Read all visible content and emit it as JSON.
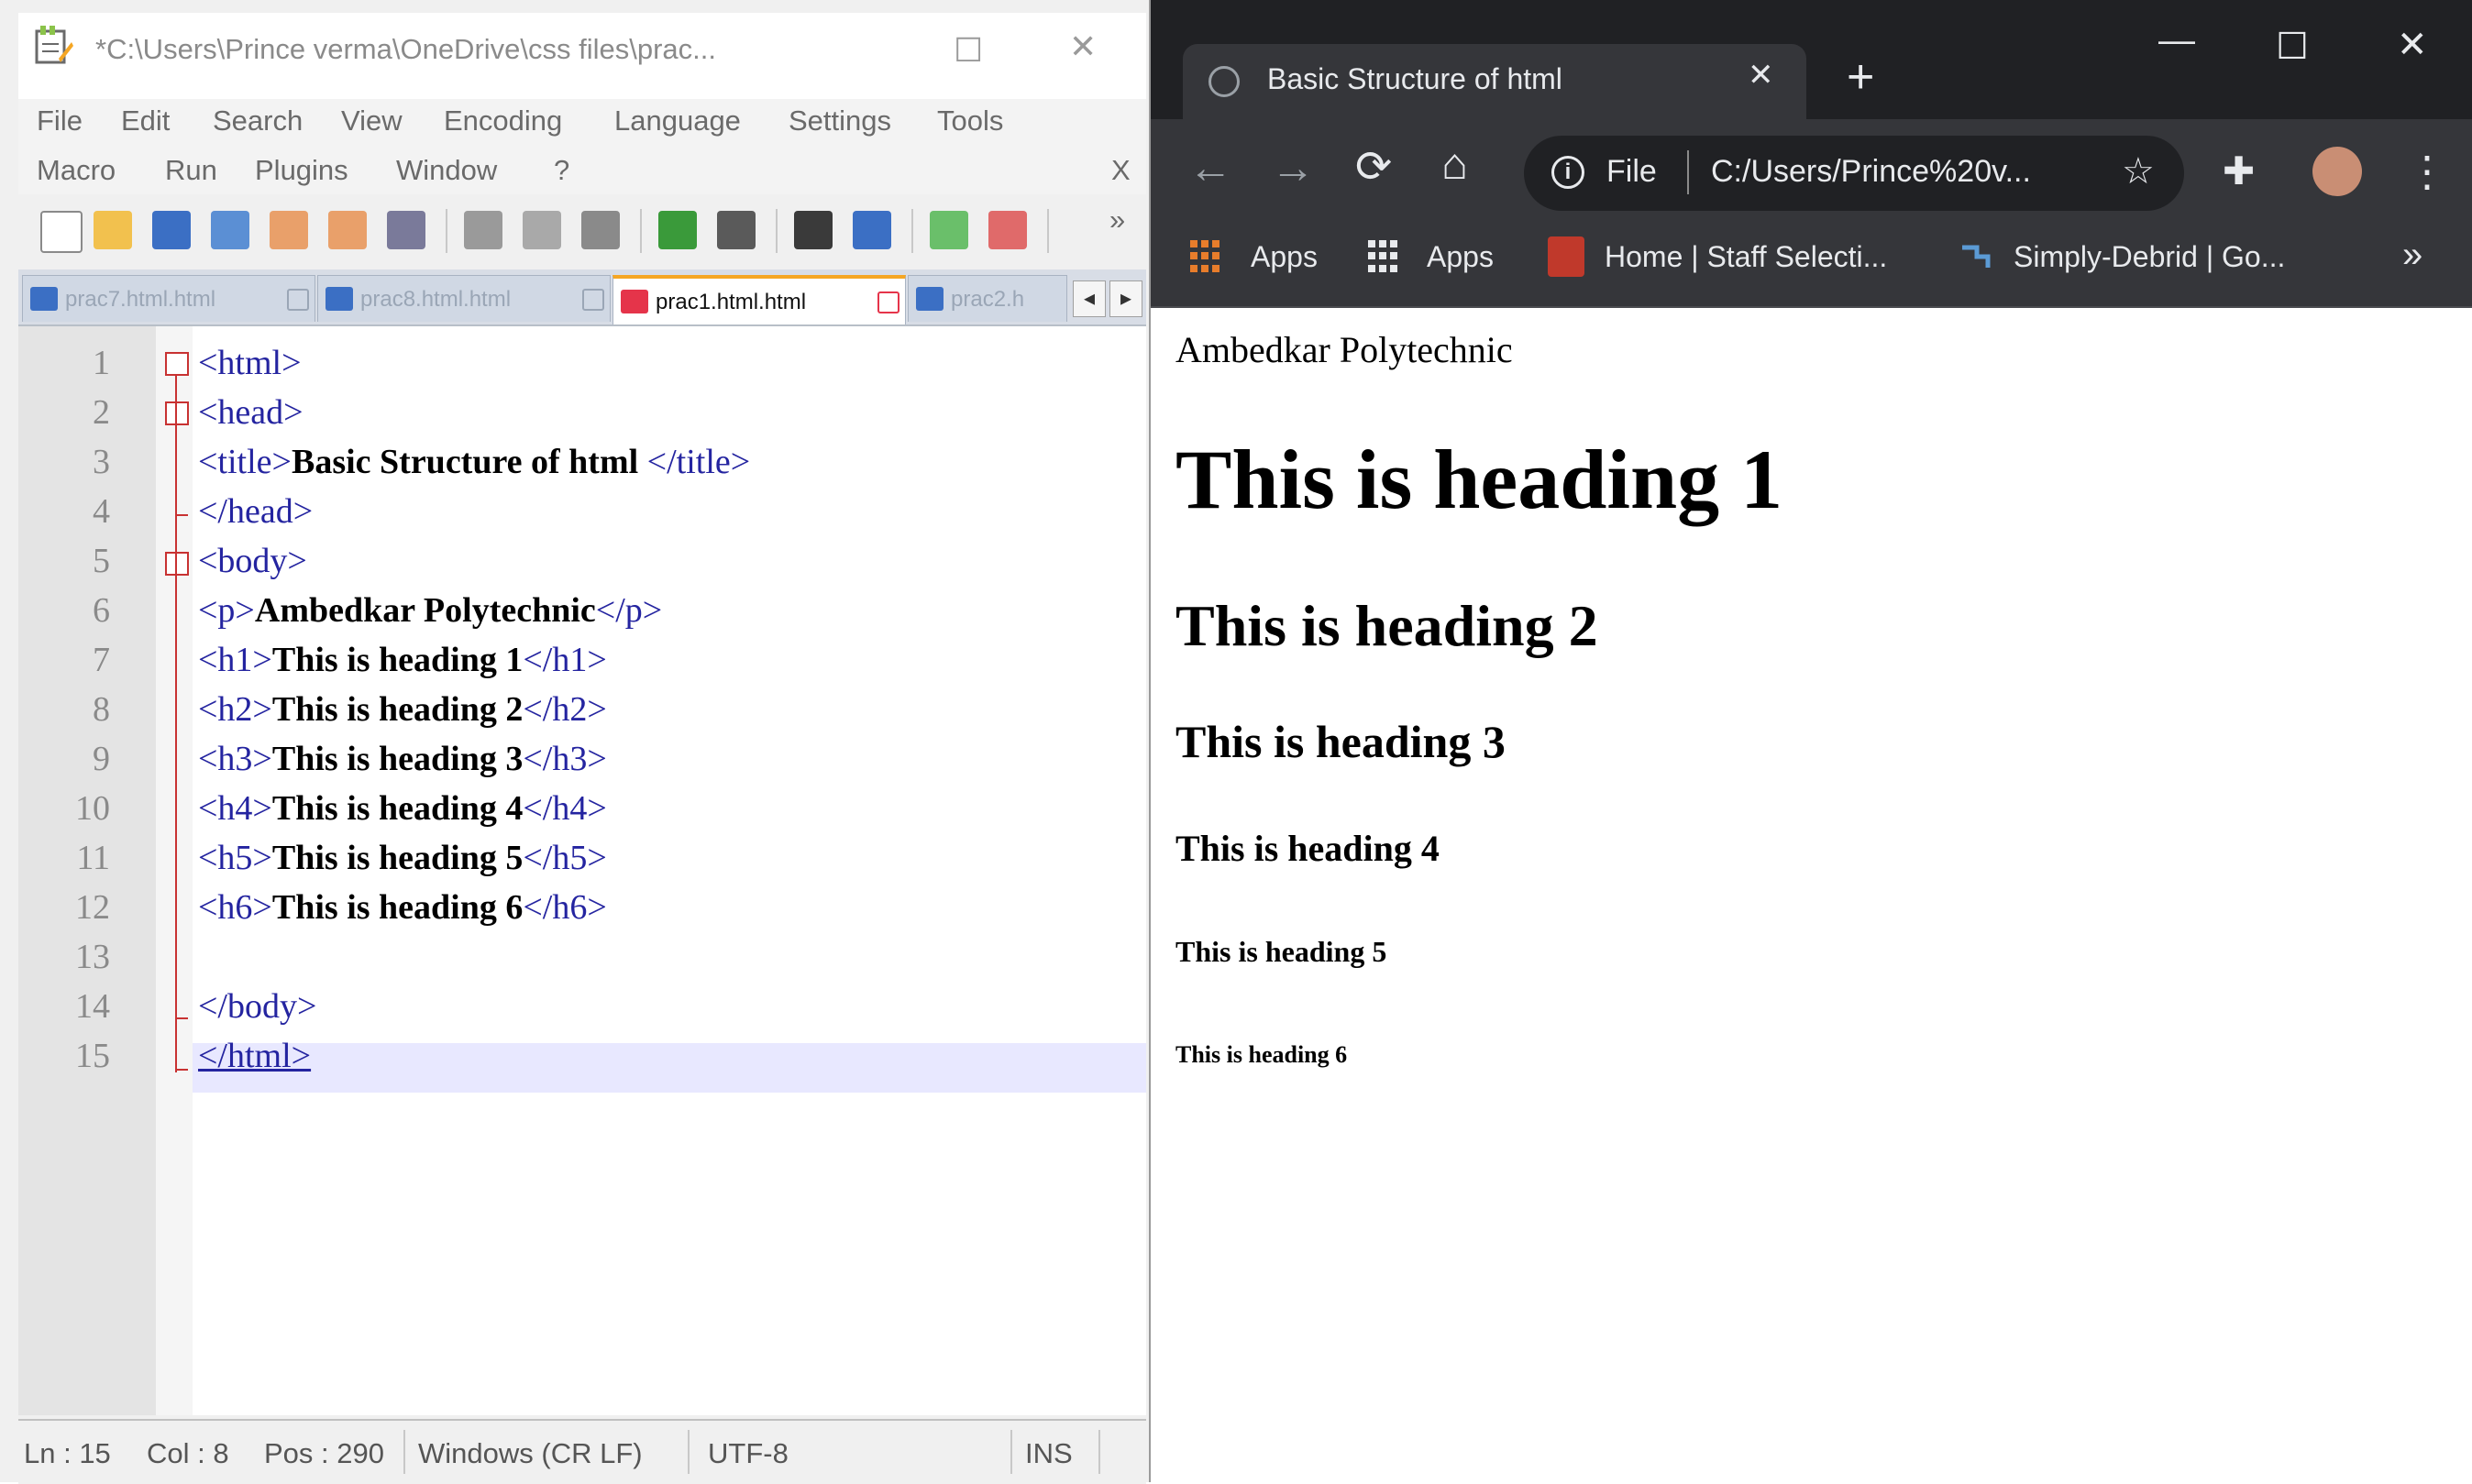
{
  "notepad": {
    "title": "*C:\\Users\\Prince verma\\OneDrive\\css files\\prac...",
    "menu_row1": [
      "File",
      "Edit",
      "Search",
      "View",
      "Encoding",
      "Language",
      "Settings",
      "Tools"
    ],
    "menu_row2": [
      "Macro",
      "Run",
      "Plugins",
      "Window",
      "?"
    ],
    "menu_close": "X",
    "toolbar_more": "»",
    "tabs": [
      {
        "label": "prac7.html.html",
        "active": false
      },
      {
        "label": "prac8.html.html",
        "active": false
      },
      {
        "label": "prac1.html.html",
        "active": true
      },
      {
        "label": "prac2.h",
        "active": false
      }
    ],
    "tab_scroll_left": "◂",
    "tab_scroll_right": "▸",
    "line_numbers": [
      "1",
      "2",
      "3",
      "4",
      "5",
      "6",
      "7",
      "8",
      "9",
      "10",
      "11",
      "12",
      "13",
      "14",
      "15"
    ],
    "code": [
      {
        "open": "<html>",
        "text": "",
        "close": ""
      },
      {
        "open": "<head>",
        "text": "",
        "close": ""
      },
      {
        "open": "<title>",
        "text": "Basic Structure of html ",
        "close": "</title>"
      },
      {
        "open": "</head>",
        "text": "",
        "close": ""
      },
      {
        "open": "<body>",
        "text": "",
        "close": ""
      },
      {
        "open": "<p>",
        "text": "Ambedkar Polytechnic",
        "close": "</p>"
      },
      {
        "open": "<h1>",
        "text": "This is heading 1",
        "close": "</h1>"
      },
      {
        "open": "<h2>",
        "text": "This is heading 2",
        "close": "</h2>"
      },
      {
        "open": "<h3>",
        "text": "This is heading 3",
        "close": "</h3>"
      },
      {
        "open": "<h4>",
        "text": "This is heading 4",
        "close": "</h4>"
      },
      {
        "open": "<h5>",
        "text": "This is heading 5",
        "close": "</h5>"
      },
      {
        "open": "<h6>",
        "text": "This is heading 6",
        "close": "</h6>"
      },
      {
        "open": "",
        "text": "",
        "close": ""
      },
      {
        "open": "</body>",
        "text": "",
        "close": ""
      },
      {
        "open": "</html>",
        "text": "",
        "close": ""
      }
    ],
    "status": {
      "line": "Ln : 15",
      "col": "Col : 8",
      "pos": "Pos : 290",
      "eol": "Windows (CR LF)",
      "encoding": "UTF-8",
      "mode": "INS"
    }
  },
  "chrome": {
    "tab_title": "Basic Structure of html",
    "tab_close": "✕",
    "new_tab": "+",
    "scheme": "File",
    "url": "C:/Users/Prince%20v...",
    "bookmarks": [
      "Apps",
      "Apps",
      "Home | Staff Selecti...",
      "Simply-Debrid | Go..."
    ],
    "bookmarks_more": "»",
    "page": {
      "p": "Ambedkar Polytechnic",
      "h1": "This is heading 1",
      "h2": "This is heading 2",
      "h3": "This is heading 3",
      "h4": "This is heading 4",
      "h5": "This is heading 5",
      "h6": "This is heading 6"
    }
  }
}
